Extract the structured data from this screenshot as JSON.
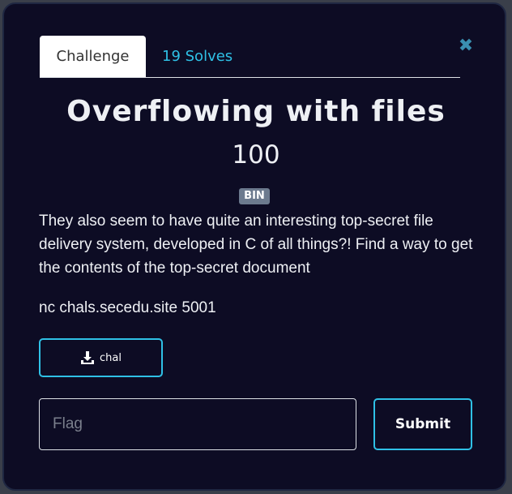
{
  "tabs": {
    "challenge_label": "Challenge",
    "solves_label": "19 Solves"
  },
  "close_symbol": "✖",
  "challenge": {
    "name": "Overflowing with files",
    "value": "100",
    "tag": "BIN",
    "description": "They also seem to have quite an interesting top-secret file delivery system, developed in C of all things?! Find a way to get the contents of the top-secret document",
    "connection": "nc chals.secedu.site 5001"
  },
  "file": {
    "label": "chal",
    "icon": "download-icon"
  },
  "flag": {
    "placeholder": "Flag",
    "value": ""
  },
  "submit": {
    "label": "Submit"
  },
  "colors": {
    "background": "#0d0c24",
    "accent": "#2fc1e6",
    "close": "#3a8fb0",
    "tag": "#6c7a8e",
    "text": "#eef0f4"
  }
}
